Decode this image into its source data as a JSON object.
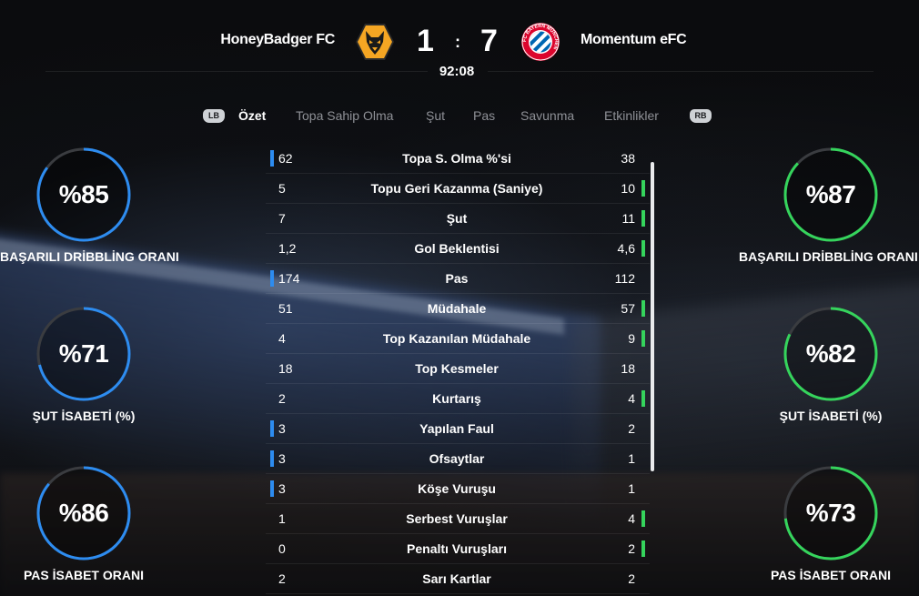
{
  "match": {
    "home_team": "HoneyBadger FC",
    "away_team": "Momentum eFC",
    "home_score": "1",
    "away_score": "7",
    "separator": ":",
    "time": "92:08",
    "home_crest_icon": "wolves-crest-icon",
    "away_crest_icon": "bayern-munchen-crest-icon",
    "away_crest_text": "FC BAYERN MÜNCHEN"
  },
  "tabs": {
    "lb": "LB",
    "rb": "RB",
    "items": [
      "Özet",
      "Topa Sahip Olma",
      "Şut",
      "Pas",
      "Savunma",
      "Etkinlikler"
    ],
    "active_index": 0
  },
  "home_rings": [
    {
      "value": "%85",
      "label": "BAŞARILI DRİBBLİNG ORANI",
      "fraction": 0.85
    },
    {
      "value": "%71",
      "label": "ŞUT İSABETİ (%)",
      "fraction": 0.71
    },
    {
      "value": "%86",
      "label": "PAS İSABET ORANI",
      "fraction": 0.86
    }
  ],
  "away_rings": [
    {
      "value": "%87",
      "label": "BAŞARILI DRİBBLİNG ORANI",
      "fraction": 0.87
    },
    {
      "value": "%82",
      "label": "ŞUT İSABETİ (%)",
      "fraction": 0.82
    },
    {
      "value": "%73",
      "label": "PAS İSABET ORANI",
      "fraction": 0.73
    }
  ],
  "stats": [
    {
      "home": "62",
      "label": "Topa S. Olma %'si",
      "away": "38",
      "leader": "home"
    },
    {
      "home": "5",
      "label": "Topu Geri Kazanma (Saniye)",
      "away": "10",
      "leader": "away"
    },
    {
      "home": "7",
      "label": "Şut",
      "away": "11",
      "leader": "away"
    },
    {
      "home": "1,2",
      "label": "Gol Beklentisi",
      "away": "4,6",
      "leader": "away"
    },
    {
      "home": "174",
      "label": "Pas",
      "away": "112",
      "leader": "home"
    },
    {
      "home": "51",
      "label": "Müdahale",
      "away": "57",
      "leader": "away"
    },
    {
      "home": "4",
      "label": "Top Kazanılan Müdahale",
      "away": "9",
      "leader": "away"
    },
    {
      "home": "18",
      "label": "Top Kesmeler",
      "away": "18",
      "leader": "none"
    },
    {
      "home": "2",
      "label": "Kurtarış",
      "away": "4",
      "leader": "away"
    },
    {
      "home": "3",
      "label": "Yapılan Faul",
      "away": "2",
      "leader": "home"
    },
    {
      "home": "3",
      "label": "Ofsaytlar",
      "away": "1",
      "leader": "home"
    },
    {
      "home": "3",
      "label": "Köşe Vuruşu",
      "away": "1",
      "leader": "home"
    },
    {
      "home": "1",
      "label": "Serbest Vuruşlar",
      "away": "4",
      "leader": "away"
    },
    {
      "home": "0",
      "label": "Penaltı Vuruşları",
      "away": "2",
      "leader": "away"
    },
    {
      "home": "2",
      "label": "Sarı Kartlar",
      "away": "2",
      "leader": "none"
    }
  ],
  "colors": {
    "home_accent": "#2d8cf0",
    "away_accent": "#35d45c",
    "ring_track": "#3a3c40"
  }
}
